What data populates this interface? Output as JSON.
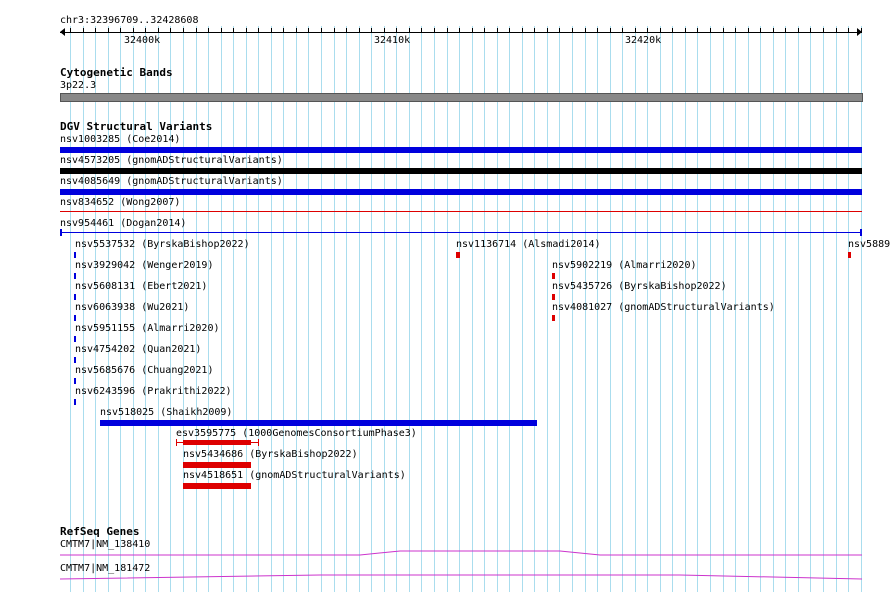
{
  "region": "chr3:32396709..32428608",
  "ruler": {
    "ticks": [
      "32400k",
      "32410k",
      "32420k"
    ]
  },
  "tracks": {
    "cytoband": {
      "title": "Cytogenetic Bands",
      "band": "3p22.3"
    },
    "dgv": {
      "title": "DGV Structural Variants",
      "features": [
        {
          "name": "nsv1003285 (Coe2014)",
          "color": "#0000dd"
        },
        {
          "name": "nsv4573205 (gnomADStructuralVariants)",
          "color": "#000000"
        },
        {
          "name": "nsv4085649 (gnomADStructuralVariants)",
          "color": "#0000dd"
        },
        {
          "name": "nsv834652 (Wong2007)",
          "color": "#dd0000"
        },
        {
          "name": "nsv954461 (Dogan2014)",
          "color": "#0000dd"
        },
        {
          "name": "nsv5537532 (ByrskaBishop2022)",
          "color": "#0000dd"
        },
        {
          "name": "nsv1136714 (Alsmadi2014)",
          "color": "#dd0000"
        },
        {
          "name": "nsv5889",
          "color": "#dd0000"
        },
        {
          "name": "nsv3929042 (Wenger2019)",
          "color": "#0000dd"
        },
        {
          "name": "nsv5902219 (Almarri2020)",
          "color": "#dd0000"
        },
        {
          "name": "nsv5608131 (Ebert2021)",
          "color": "#0000dd"
        },
        {
          "name": "nsv5435726 (ByrskaBishop2022)",
          "color": "#dd0000"
        },
        {
          "name": "nsv6063938 (Wu2021)",
          "color": "#0000dd"
        },
        {
          "name": "nsv4081027 (gnomADStructuralVariants)",
          "color": "#dd0000"
        },
        {
          "name": "nsv5951155 (Almarri2020)",
          "color": "#0000dd"
        },
        {
          "name": "nsv4754202 (Quan2021)",
          "color": "#0000dd"
        },
        {
          "name": "nsv5685676 (Chuang2021)",
          "color": "#0000dd"
        },
        {
          "name": "nsv6243596 (Prakrithi2022)",
          "color": "#0000dd"
        },
        {
          "name": "nsv518025 (Shaikh2009)",
          "color": "#0000dd"
        },
        {
          "name": "esv3595775 (1000GenomesConsortiumPhase3)",
          "color": "#dd0000"
        },
        {
          "name": "nsv5434686 (ByrskaBishop2022)",
          "color": "#dd0000"
        },
        {
          "name": "nsv4518651 (gnomADStructuralVariants)",
          "color": "#dd0000"
        }
      ]
    },
    "refseq": {
      "title": "RefSeq Genes",
      "genes": [
        {
          "name": "CMTM7|NM_138410",
          "color": "#cc33cc"
        },
        {
          "name": "CMTM7|NM_181472",
          "color": "#cc33cc"
        }
      ]
    }
  }
}
